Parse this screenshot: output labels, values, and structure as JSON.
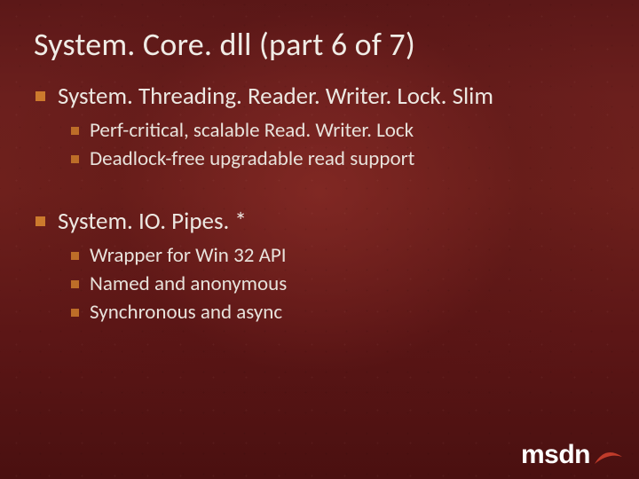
{
  "title": "System. Core. dll (part 6 of 7)",
  "sections": [
    {
      "heading": "System. Threading. Reader. Writer. Lock. Slim",
      "items": [
        "Perf-critical, scalable Read. Writer. Lock",
        "Deadlock-free upgradable read support"
      ]
    },
    {
      "heading": "System. IO. Pipes. *",
      "items": [
        "Wrapper for Win 32 API",
        "Named and anonymous",
        "Synchronous and async"
      ]
    }
  ],
  "logo_text": "msdn",
  "colors": {
    "accent_bullet": "#cc7a2d",
    "text": "#e8e4df",
    "logo_swoosh": "#c13b2a"
  }
}
